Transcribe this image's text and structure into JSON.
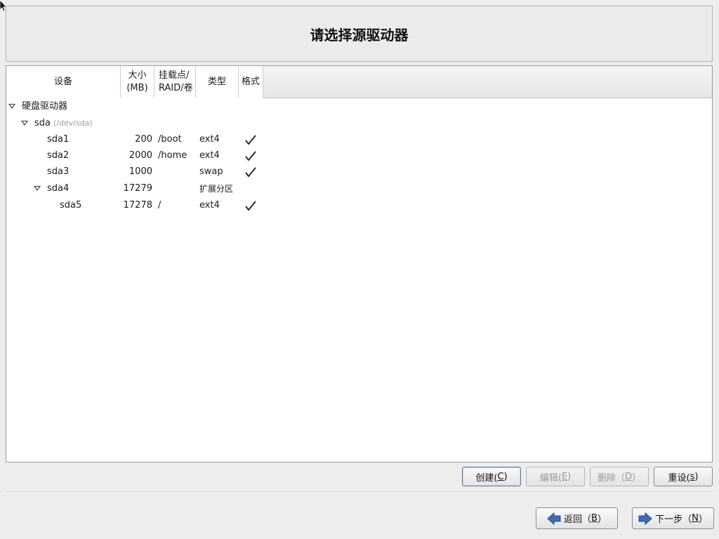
{
  "header": {
    "title": "请选择源驱动器"
  },
  "columns": {
    "device": "设备",
    "size_line1": "大小",
    "size_line2": "(MB)",
    "mount_line1": "挂载点/",
    "mount_line2": "RAID/卷",
    "type": "类型",
    "format": "格式"
  },
  "tree": {
    "group": {
      "label": "硬盘驱动器"
    },
    "disk": {
      "label": "sda",
      "path": "(/dev/sda)"
    },
    "partitions": [
      {
        "name": "sda1",
        "size": "200",
        "mount": "/boot",
        "type": "ext4",
        "format": true
      },
      {
        "name": "sda2",
        "size": "2000",
        "mount": "/home",
        "type": "ext4",
        "format": true
      },
      {
        "name": "sda3",
        "size": "1000",
        "mount": "",
        "type": "swap",
        "format": true
      },
      {
        "name": "sda4",
        "size": "17279",
        "mount": "",
        "type": "扩展分区",
        "format": false
      },
      {
        "name": "sda5",
        "size": "17278",
        "mount": "/",
        "type": "ext4",
        "format": true
      }
    ]
  },
  "actions": {
    "create": {
      "label": "创建(",
      "key": "C",
      "suffix": ")"
    },
    "edit": {
      "label": "编辑(",
      "key": "E",
      "suffix": ")"
    },
    "delete": {
      "label": "删除（",
      "key": "D",
      "suffix": "）"
    },
    "reset": {
      "label": "重设(",
      "key": "s",
      "suffix": ")"
    }
  },
  "nav": {
    "back": {
      "label": "返回（",
      "key": "B",
      "suffix": "）"
    },
    "next": {
      "label": "下一步（",
      "key": "N",
      "suffix": "）"
    }
  },
  "colors": {
    "accent": "#3a6fb0",
    "check": "#2a2a3a"
  }
}
